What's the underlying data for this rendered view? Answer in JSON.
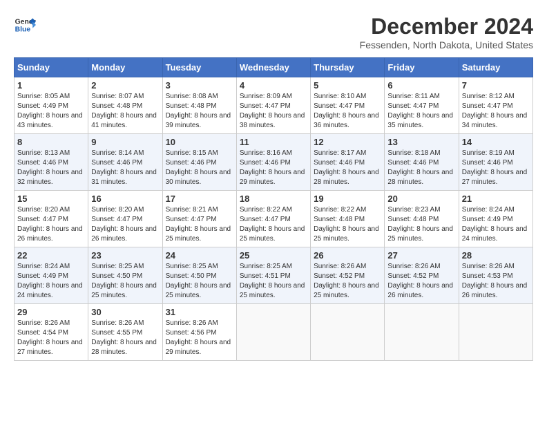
{
  "header": {
    "logo_line1": "General",
    "logo_line2": "Blue",
    "month_title": "December 2024",
    "location": "Fessenden, North Dakota, United States"
  },
  "days_of_week": [
    "Sunday",
    "Monday",
    "Tuesday",
    "Wednesday",
    "Thursday",
    "Friday",
    "Saturday"
  ],
  "weeks": [
    [
      {
        "day": "1",
        "sunrise": "8:05 AM",
        "sunset": "4:49 PM",
        "daylight": "8 hours and 43 minutes."
      },
      {
        "day": "2",
        "sunrise": "8:07 AM",
        "sunset": "4:48 PM",
        "daylight": "8 hours and 41 minutes."
      },
      {
        "day": "3",
        "sunrise": "8:08 AM",
        "sunset": "4:48 PM",
        "daylight": "8 hours and 39 minutes."
      },
      {
        "day": "4",
        "sunrise": "8:09 AM",
        "sunset": "4:47 PM",
        "daylight": "8 hours and 38 minutes."
      },
      {
        "day": "5",
        "sunrise": "8:10 AM",
        "sunset": "4:47 PM",
        "daylight": "8 hours and 36 minutes."
      },
      {
        "day": "6",
        "sunrise": "8:11 AM",
        "sunset": "4:47 PM",
        "daylight": "8 hours and 35 minutes."
      },
      {
        "day": "7",
        "sunrise": "8:12 AM",
        "sunset": "4:47 PM",
        "daylight": "8 hours and 34 minutes."
      }
    ],
    [
      {
        "day": "8",
        "sunrise": "8:13 AM",
        "sunset": "4:46 PM",
        "daylight": "8 hours and 32 minutes."
      },
      {
        "day": "9",
        "sunrise": "8:14 AM",
        "sunset": "4:46 PM",
        "daylight": "8 hours and 31 minutes."
      },
      {
        "day": "10",
        "sunrise": "8:15 AM",
        "sunset": "4:46 PM",
        "daylight": "8 hours and 30 minutes."
      },
      {
        "day": "11",
        "sunrise": "8:16 AM",
        "sunset": "4:46 PM",
        "daylight": "8 hours and 29 minutes."
      },
      {
        "day": "12",
        "sunrise": "8:17 AM",
        "sunset": "4:46 PM",
        "daylight": "8 hours and 28 minutes."
      },
      {
        "day": "13",
        "sunrise": "8:18 AM",
        "sunset": "4:46 PM",
        "daylight": "8 hours and 28 minutes."
      },
      {
        "day": "14",
        "sunrise": "8:19 AM",
        "sunset": "4:46 PM",
        "daylight": "8 hours and 27 minutes."
      }
    ],
    [
      {
        "day": "15",
        "sunrise": "8:20 AM",
        "sunset": "4:47 PM",
        "daylight": "8 hours and 26 minutes."
      },
      {
        "day": "16",
        "sunrise": "8:20 AM",
        "sunset": "4:47 PM",
        "daylight": "8 hours and 26 minutes."
      },
      {
        "day": "17",
        "sunrise": "8:21 AM",
        "sunset": "4:47 PM",
        "daylight": "8 hours and 25 minutes."
      },
      {
        "day": "18",
        "sunrise": "8:22 AM",
        "sunset": "4:47 PM",
        "daylight": "8 hours and 25 minutes."
      },
      {
        "day": "19",
        "sunrise": "8:22 AM",
        "sunset": "4:48 PM",
        "daylight": "8 hours and 25 minutes."
      },
      {
        "day": "20",
        "sunrise": "8:23 AM",
        "sunset": "4:48 PM",
        "daylight": "8 hours and 25 minutes."
      },
      {
        "day": "21",
        "sunrise": "8:24 AM",
        "sunset": "4:49 PM",
        "daylight": "8 hours and 24 minutes."
      }
    ],
    [
      {
        "day": "22",
        "sunrise": "8:24 AM",
        "sunset": "4:49 PM",
        "daylight": "8 hours and 24 minutes."
      },
      {
        "day": "23",
        "sunrise": "8:25 AM",
        "sunset": "4:50 PM",
        "daylight": "8 hours and 25 minutes."
      },
      {
        "day": "24",
        "sunrise": "8:25 AM",
        "sunset": "4:50 PM",
        "daylight": "8 hours and 25 minutes."
      },
      {
        "day": "25",
        "sunrise": "8:25 AM",
        "sunset": "4:51 PM",
        "daylight": "8 hours and 25 minutes."
      },
      {
        "day": "26",
        "sunrise": "8:26 AM",
        "sunset": "4:52 PM",
        "daylight": "8 hours and 25 minutes."
      },
      {
        "day": "27",
        "sunrise": "8:26 AM",
        "sunset": "4:52 PM",
        "daylight": "8 hours and 26 minutes."
      },
      {
        "day": "28",
        "sunrise": "8:26 AM",
        "sunset": "4:53 PM",
        "daylight": "8 hours and 26 minutes."
      }
    ],
    [
      {
        "day": "29",
        "sunrise": "8:26 AM",
        "sunset": "4:54 PM",
        "daylight": "8 hours and 27 minutes."
      },
      {
        "day": "30",
        "sunrise": "8:26 AM",
        "sunset": "4:55 PM",
        "daylight": "8 hours and 28 minutes."
      },
      {
        "day": "31",
        "sunrise": "8:26 AM",
        "sunset": "4:56 PM",
        "daylight": "8 hours and 29 minutes."
      },
      null,
      null,
      null,
      null
    ]
  ],
  "labels": {
    "sunrise": "Sunrise:",
    "sunset": "Sunset:",
    "daylight": "Daylight:"
  }
}
